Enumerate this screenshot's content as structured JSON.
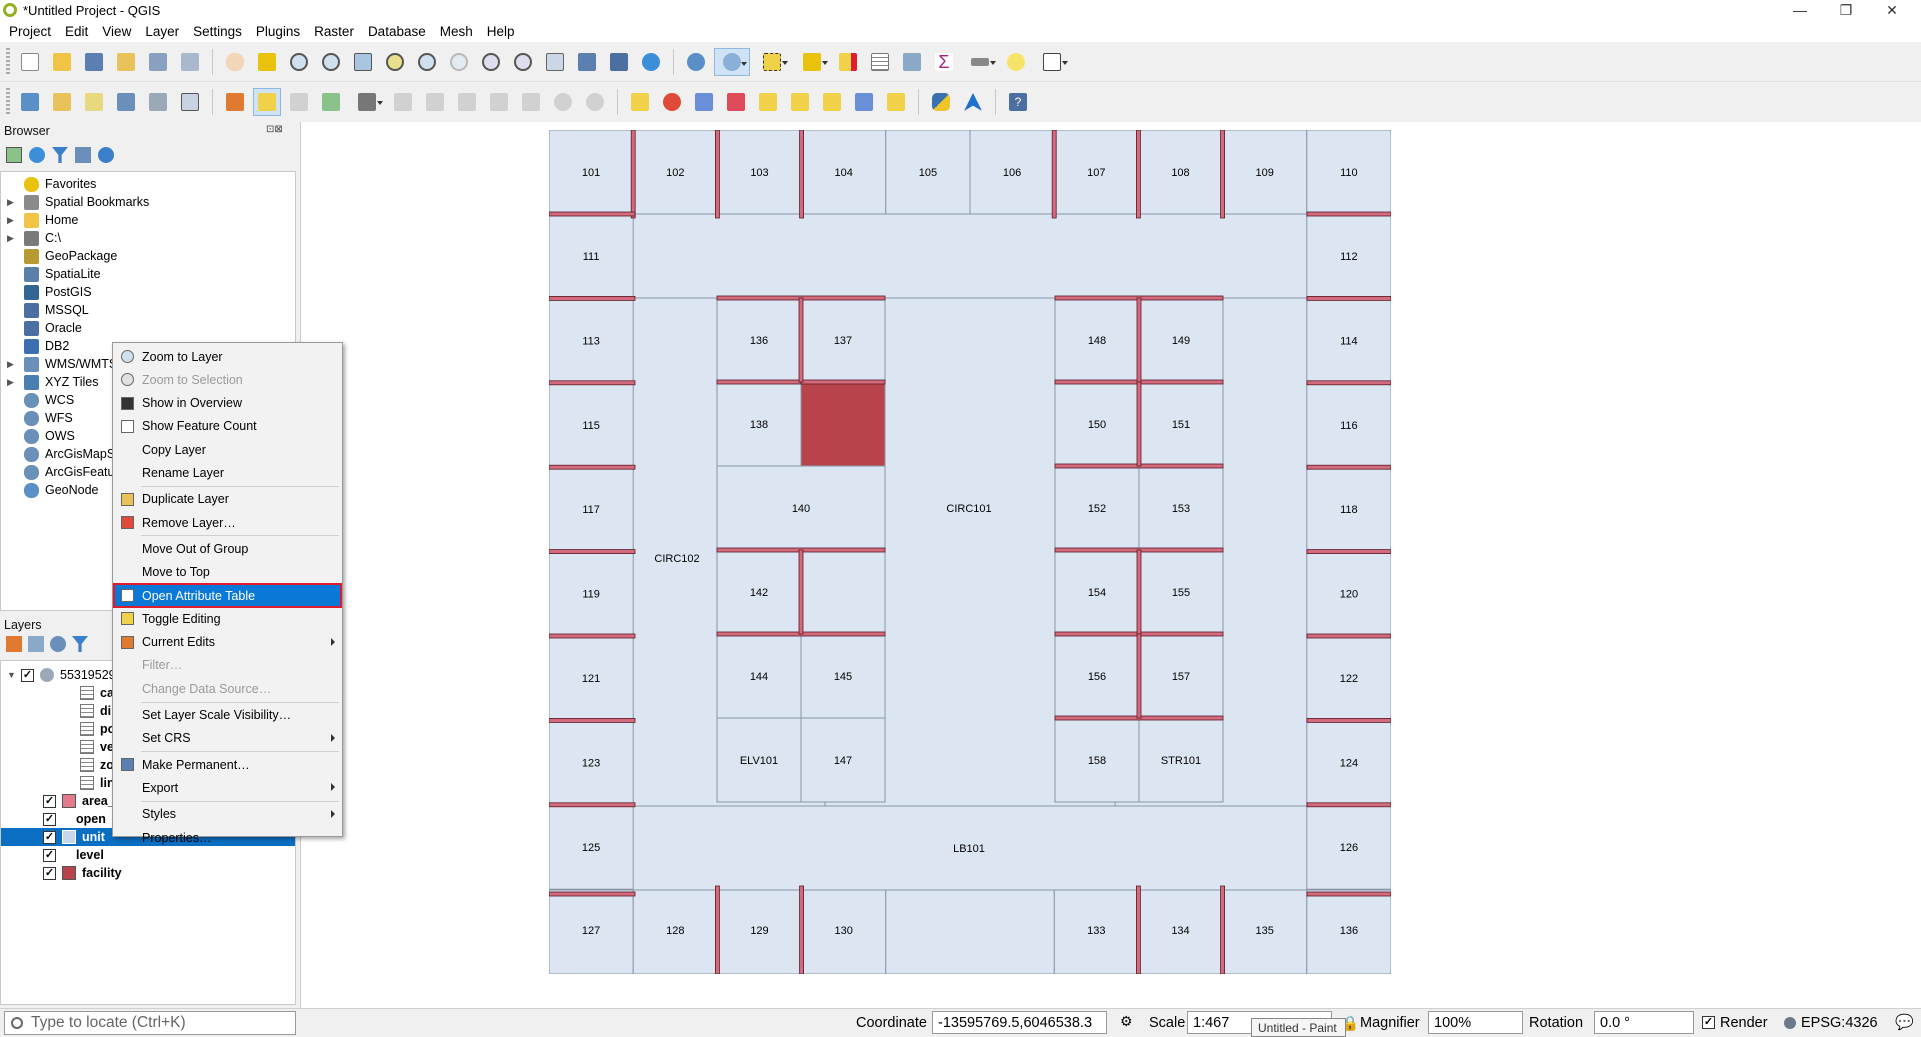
{
  "window": {
    "title": "*Untitled Project - QGIS",
    "minimize": "—",
    "restore": "❐",
    "close": "✕"
  },
  "menu": [
    "Project",
    "Edit",
    "View",
    "Layer",
    "Settings",
    "Plugins",
    "Raster",
    "Database",
    "Mesh",
    "Help"
  ],
  "browser": {
    "title": "Browser",
    "items": [
      {
        "label": "Favorites",
        "icon": "star-icon",
        "expand": false,
        "color": "#e8c20b"
      },
      {
        "label": "Spatial Bookmarks",
        "icon": "bookmark-icon",
        "expand": true,
        "color": "#8a8a8a"
      },
      {
        "label": "Home",
        "icon": "folder-icon",
        "expand": true,
        "color": "#f0c545"
      },
      {
        "label": "C:\\",
        "icon": "drive-icon",
        "expand": true,
        "color": "#7a7a7a"
      },
      {
        "label": "GeoPackage",
        "icon": "geopackage-icon",
        "expand": false,
        "color": "#b89a32"
      },
      {
        "label": "SpatiaLite",
        "icon": "spatialite-icon",
        "expand": false,
        "color": "#5a7fa8"
      },
      {
        "label": "PostGIS",
        "icon": "postgis-icon",
        "expand": false,
        "color": "#336791"
      },
      {
        "label": "MSSQL",
        "icon": "mssql-icon",
        "expand": false,
        "color": "#4a6fa0"
      },
      {
        "label": "Oracle",
        "icon": "oracle-icon",
        "expand": false,
        "color": "#4a6fa0"
      },
      {
        "label": "DB2",
        "icon": "db2-icon",
        "expand": false,
        "color": "#3d6fb0"
      },
      {
        "label": "WMS/WMTS",
        "icon": "wms-icon",
        "expand": true,
        "color": "#6a8fb8"
      },
      {
        "label": "XYZ Tiles",
        "icon": "xyz-tiles-icon",
        "expand": true,
        "color": "#4a7fb0"
      },
      {
        "label": "WCS",
        "icon": "wcs-icon",
        "expand": false,
        "color": "#6a8fb8"
      },
      {
        "label": "WFS",
        "icon": "wfs-icon",
        "expand": false,
        "color": "#6a8fb8"
      },
      {
        "label": "OWS",
        "icon": "ows-icon",
        "expand": false,
        "color": "#6a8fb8"
      },
      {
        "label": "ArcGisMapServer",
        "icon": "arcgis-map-icon",
        "expand": false,
        "color": "#6a8fb8"
      },
      {
        "label": "ArcGisFeatureServer",
        "icon": "arcgis-feature-icon",
        "expand": false,
        "color": "#6a8fb8"
      },
      {
        "label": "GeoNode",
        "icon": "geonode-icon",
        "expand": false,
        "color": "#5a8fc8"
      }
    ]
  },
  "layers": {
    "title": "Layers",
    "group": "55319529",
    "items": [
      {
        "label": "category",
        "kind": "table",
        "checked": false
      },
      {
        "label": "directory",
        "kind": "table",
        "checked": false
      },
      {
        "label": "point_ele",
        "kind": "table",
        "checked": false
      },
      {
        "label": "vertical_",
        "kind": "table",
        "checked": false
      },
      {
        "label": "zone",
        "kind": "table",
        "checked": false
      },
      {
        "label": "line_elem",
        "kind": "table",
        "checked": false
      },
      {
        "label": "area_",
        "kind": "polygon",
        "checked": true,
        "color": "#e27a8c"
      },
      {
        "label": "open",
        "kind": "line",
        "checked": true
      },
      {
        "label": "unit",
        "kind": "editing",
        "checked": true,
        "selected": true
      },
      {
        "label": "level",
        "kind": "line",
        "checked": true
      },
      {
        "label": "facility",
        "kind": "polygon",
        "checked": true,
        "color": "#b8434a"
      }
    ]
  },
  "context_menu": [
    {
      "label": "Zoom to Layer",
      "icon": "zoom-layer-icon",
      "underline": "Z"
    },
    {
      "label": "Zoom to Selection",
      "icon": "zoom-selection-icon",
      "disabled": true
    },
    {
      "label": "Show in Overview",
      "icon": "overview-icon"
    },
    {
      "label": "Show Feature Count",
      "icon": "checkbox-icon"
    },
    {
      "label": "Copy Layer"
    },
    {
      "label": "Rename Layer"
    },
    {
      "sep": true
    },
    {
      "label": "Duplicate Layer",
      "icon": "duplicate-icon"
    },
    {
      "label": "Remove Layer…",
      "icon": "remove-icon"
    },
    {
      "sep": true
    },
    {
      "label": "Move Out of Group"
    },
    {
      "label": "Move to Top"
    },
    {
      "label": "Open Attribute Table",
      "icon": "attribute-table-icon",
      "highlighted": true
    },
    {
      "label": "Toggle Editing",
      "icon": "pencil-icon"
    },
    {
      "label": "Current Edits",
      "icon": "edits-icon",
      "submenu": true
    },
    {
      "label": "Filter…",
      "disabled": true
    },
    {
      "label": "Change Data Source…",
      "disabled": true
    },
    {
      "sep": true
    },
    {
      "label": "Set Layer Scale Visibility…"
    },
    {
      "label": "Set CRS",
      "submenu": true
    },
    {
      "sep": true
    },
    {
      "label": "Make Permanent…",
      "icon": "save-icon"
    },
    {
      "label": "Export",
      "submenu": true
    },
    {
      "sep": true
    },
    {
      "label": "Styles",
      "submenu": true
    },
    {
      "label": "Properties…"
    }
  ],
  "floorplan": {
    "top_units": [
      "101",
      "102",
      "103",
      "104",
      "105",
      "106",
      "107",
      "108",
      "109",
      "110"
    ],
    "left_units": [
      "111",
      "113",
      "115",
      "117",
      "119",
      "121",
      "123",
      "125"
    ],
    "right_units": [
      "112",
      "114",
      "116",
      "118",
      "120",
      "122",
      "124",
      "126"
    ],
    "bottom_units": [
      "127",
      "128",
      "129",
      "130",
      "133",
      "134",
      "135",
      "136"
    ],
    "inner_left": [
      "136",
      "137",
      "138",
      "140",
      "142",
      "144",
      "145",
      "ELV101",
      "147"
    ],
    "inner_right": [
      "148",
      "149",
      "150",
      "151",
      "152",
      "153",
      "154",
      "155",
      "156",
      "157",
      "158",
      "STR101"
    ],
    "circulation": [
      "CIRC102",
      "CIRC101",
      "LB101"
    ],
    "colors": {
      "unit_fill": "#dce6f2",
      "wall": "#d36a7d",
      "wall_stroke": "#5a1a25",
      "highlight": "#b8434a",
      "outline": "#8a95a5"
    }
  },
  "status": {
    "locator_placeholder": "Type to locate (Ctrl+K)",
    "coordinate_label": "Coordinate",
    "coordinate": "-13595769.5,6046538.3",
    "scale_label": "Scale",
    "scale": "1:467",
    "tooltip": "Untitled - Paint",
    "magnifier_label": "Magnifier",
    "magnifier": "100%",
    "rotation_label": "Rotation",
    "rotation": "0.0 °",
    "render_label": "Render",
    "crs": "EPSG:4326"
  }
}
